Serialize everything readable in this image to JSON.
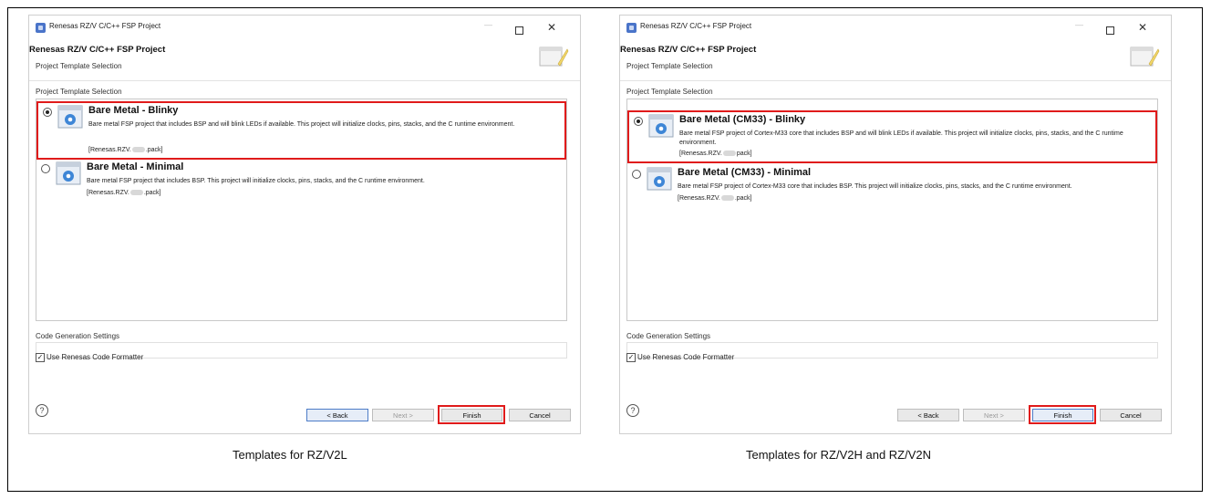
{
  "colors": {
    "highlight": "#e01b1b",
    "panel_border": "#cfcfcf"
  },
  "panels": [
    {
      "window_title": "Renesas RZ/V C/C++ FSP Project",
      "dialog_title": "Renesas RZ/V C/C++ FSP Project",
      "dialog_subtitle": "Project Template Selection",
      "group_label": "Project Template Selection",
      "templates": [
        {
          "name": "Bare Metal - Blinky",
          "selected": true,
          "description": "Bare metal FSP project that includes BSP and will blink LEDs if available. This project will initialize clocks, pins, stacks, and the C runtime environment.",
          "pack_prefix": "[Renesas.RZV.",
          "pack_suffix": ".pack]"
        },
        {
          "name": "Bare Metal - Minimal",
          "selected": false,
          "description": "Bare metal FSP project that includes BSP. This project will initialize clocks, pins, stacks, and the C runtime environment.",
          "pack_prefix": "[Renesas.RZV.",
          "pack_suffix": ".pack]"
        }
      ],
      "code_gen_label": "Code Generation Settings",
      "formatter_label": "Use Renesas Code Formatter",
      "formatter_checked": true,
      "help_icon": "?",
      "buttons": {
        "back": "< Back",
        "next": "Next >",
        "finish": "Finish",
        "cancel": "Cancel"
      },
      "caption": "Templates for RZ/V2L"
    },
    {
      "window_title": "Renesas RZ/V C/C++ FSP Project",
      "dialog_title": "Renesas RZ/V C/C++ FSP Project",
      "dialog_subtitle": "Project Template Selection",
      "group_label": "Project Template Selection",
      "templates": [
        {
          "name": "Bare Metal (CM33) - Blinky",
          "selected": true,
          "description": "Bare metal FSP project of Cortex-M33 core that includes BSP and will blink LEDs if available. This project will initialize clocks, pins, stacks, and the C runtime environment.",
          "pack_prefix": "[Renesas.RZV.",
          "pack_suffix": "pack]"
        },
        {
          "name": "Bare Metal (CM33) - Minimal",
          "selected": false,
          "description": "Bare metal FSP project of Cortex-M33 core that includes BSP. This project will initialize clocks, pins, stacks, and the C runtime environment.",
          "pack_prefix": "[Renesas.RZV.",
          "pack_suffix": ".pack]"
        }
      ],
      "code_gen_label": "Code Generation Settings",
      "formatter_label": "Use Renesas Code Formatter",
      "formatter_checked": true,
      "help_icon": "?",
      "buttons": {
        "back": "< Back",
        "next": "Next >",
        "finish": "Finish",
        "cancel": "Cancel"
      },
      "caption": "Templates for RZ/V2H and RZ/V2N"
    }
  ]
}
